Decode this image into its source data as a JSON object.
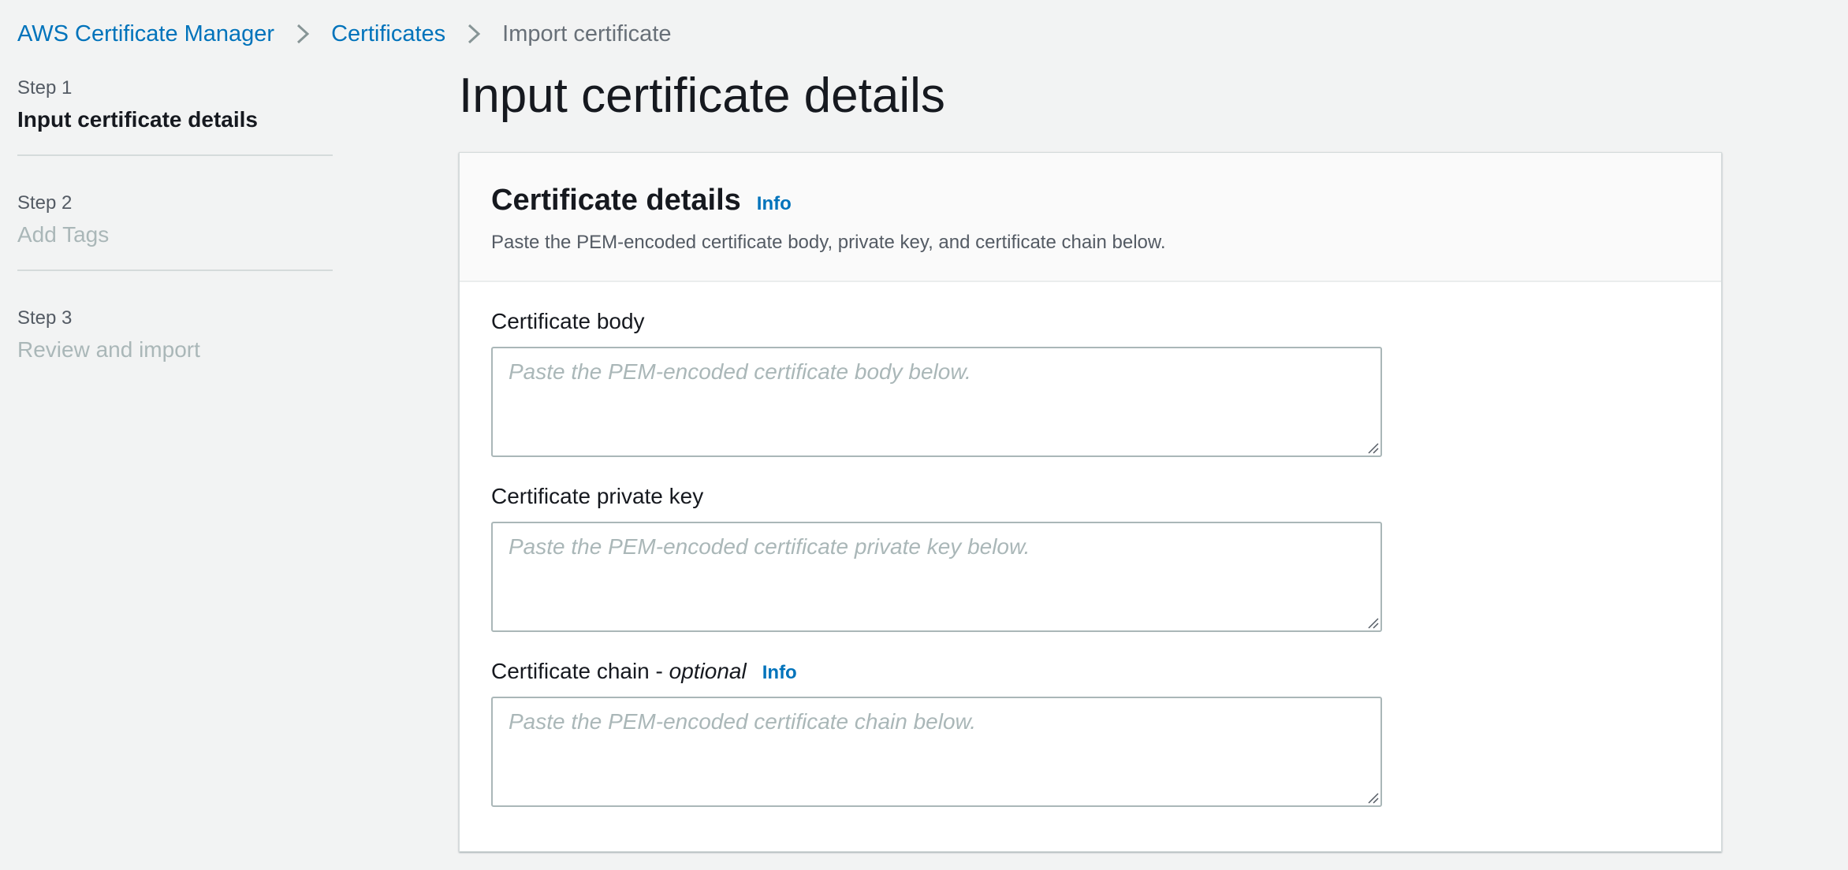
{
  "breadcrumb": {
    "items": [
      {
        "label": "AWS Certificate Manager"
      },
      {
        "label": "Certificates"
      },
      {
        "label": "Import certificate"
      }
    ]
  },
  "steps": [
    {
      "number": "Step 1",
      "title": "Input certificate details",
      "active": true
    },
    {
      "number": "Step 2",
      "title": "Add Tags",
      "active": false
    },
    {
      "number": "Step 3",
      "title": "Review and import",
      "active": false
    }
  ],
  "page": {
    "title": "Input certificate details"
  },
  "card": {
    "title": "Certificate details",
    "info_label": "Info",
    "description": "Paste the PEM-encoded certificate body, private key, and certificate chain below."
  },
  "fields": {
    "body": {
      "label": "Certificate body",
      "value": "",
      "placeholder": "Paste the PEM-encoded certificate body below."
    },
    "private_key": {
      "label": "Certificate private key",
      "value": "",
      "placeholder": "Paste the PEM-encoded certificate private key below."
    },
    "chain": {
      "label": "Certificate chain - ",
      "label_optional": "optional",
      "info_label": "Info",
      "value": "",
      "placeholder": "Paste the PEM-encoded certificate chain below."
    }
  },
  "colors": {
    "link": "#0073bb",
    "background": "#f2f3f3",
    "muted_text": "#aab7b8",
    "border": "#aab7b8"
  },
  "icons": {
    "breadcrumb_separator": "chevron-right-icon",
    "textarea_resize": "resize-handle-icon"
  }
}
